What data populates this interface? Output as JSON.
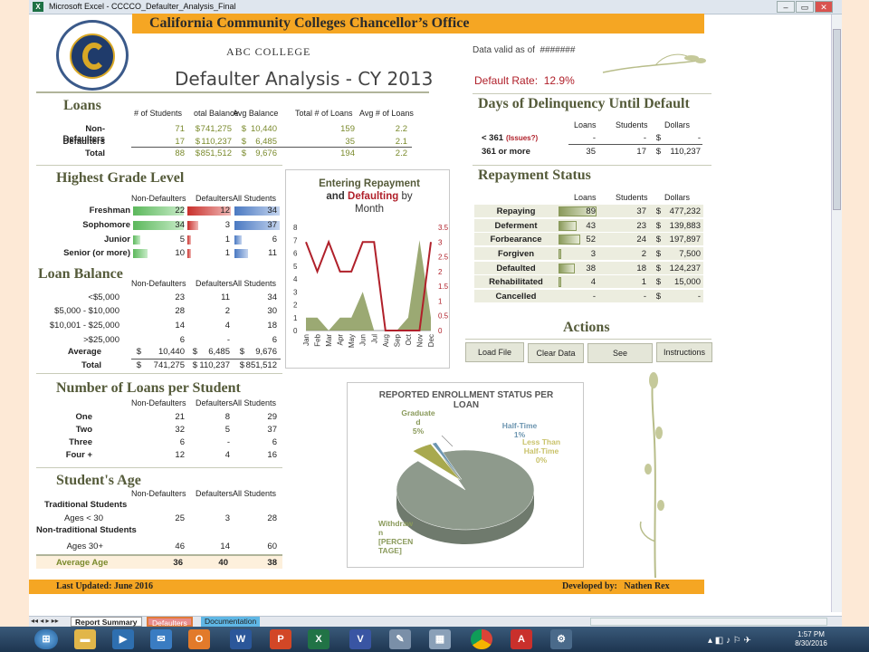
{
  "window": {
    "title": "Microsoft Excel - CCCCO_Defaulter_Analysis_Final"
  },
  "header": {
    "title": "California Community Colleges Chancellor’s Office",
    "seal_text": "CALIFORNIA COMMUNITY COLLEGES"
  },
  "report": {
    "college": "ABC COLLEGE",
    "title": "Defaulter Analysis - CY 2013",
    "valid_label": "Data valid as of",
    "valid_value": "#######",
    "default_rate_label": "Default Rate:",
    "default_rate_value": "12.9%"
  },
  "loans": {
    "title": "Loans",
    "headers": [
      "# of Students",
      "otal Balance",
      "Avg Balance",
      "Total # of Loans",
      "Avg # of Loans"
    ],
    "rows": [
      {
        "label": "Non-Defaulters",
        "students": "71",
        "bal_sym": "$",
        "balance": "741,275",
        "avg_sym": "$",
        "avg": "10,440",
        "loans": "159",
        "avg_loans": "2.2"
      },
      {
        "label": "Defaulters",
        "students": "17",
        "bal_sym": "$",
        "balance": "110,237",
        "avg_sym": "$",
        "avg": "6,485",
        "loans": "35",
        "avg_loans": "2.1"
      },
      {
        "label": "Total",
        "students": "88",
        "bal_sym": "$",
        "balance": "851,512",
        "avg_sym": "$",
        "avg": "9,676",
        "loans": "194",
        "avg_loans": "2.2"
      }
    ]
  },
  "grade": {
    "title": "Highest Grade Level",
    "headers": [
      "Non-Defaulters",
      "Defaulters",
      "All Students"
    ],
    "rows": [
      {
        "label": "Freshman",
        "non": "22",
        "def": "12",
        "all": "34",
        "non_frac": 1.0,
        "def_frac": 1.0,
        "all_frac": 1.0
      },
      {
        "label": "Sophomore",
        "non": "34",
        "def": "3",
        "all": "37",
        "non_frac": 1.0,
        "def_frac": 0.25,
        "all_frac": 1.0
      },
      {
        "label": "Junior",
        "non": "5",
        "def": "1",
        "all": "6",
        "non_frac": 0.15,
        "def_frac": 0.08,
        "all_frac": 0.16
      },
      {
        "label": "Senior (or more)",
        "non": "10",
        "def": "1",
        "all": "11",
        "non_frac": 0.29,
        "def_frac": 0.08,
        "all_frac": 0.3
      }
    ]
  },
  "loan_balance": {
    "title": "Loan Balance",
    "headers": [
      "Non-Defaulters",
      "Defaulters",
      "All Students"
    ],
    "rows": [
      {
        "label": "<$5,000",
        "non": "23",
        "def": "11",
        "all": "34"
      },
      {
        "label": "$5,000 - $10,000",
        "non": "28",
        "def": "2",
        "all": "30"
      },
      {
        "label": "$10,001 - $25,000",
        "non": "14",
        "def": "4",
        "all": "18"
      },
      {
        "label": ">$25,000",
        "non": "6",
        "def": "-",
        "all": "6"
      }
    ],
    "avg": {
      "label": "Average",
      "non": "10,440",
      "def": "6,485",
      "all": "9,676"
    },
    "total": {
      "label": "Total",
      "non": "741,275",
      "def": "110,237",
      "all": "851,512"
    }
  },
  "loans_per_student": {
    "title": "Number of Loans per Student",
    "headers": [
      "Non-Defaulters",
      "Defaulters",
      "All Students"
    ],
    "rows": [
      {
        "label": "One",
        "non": "21",
        "def": "8",
        "all": "29"
      },
      {
        "label": "Two",
        "non": "32",
        "def": "5",
        "all": "37"
      },
      {
        "label": "Three",
        "non": "6",
        "def": "-",
        "all": "6"
      },
      {
        "label": "Four +",
        "non": "12",
        "def": "4",
        "all": "16"
      }
    ]
  },
  "age": {
    "title": "Student's Age",
    "headers": [
      "Non-Defaulters",
      "Defaulters",
      "All Students"
    ],
    "traditional": "Traditional Students",
    "nontraditional": "Non-traditional Students",
    "rows": [
      {
        "label": "Ages < 30",
        "non": "25",
        "def": "3",
        "all": "28"
      },
      {
        "label": "Ages 30+",
        "non": "46",
        "def": "14",
        "all": "60"
      }
    ],
    "avg": {
      "label": "Average Age",
      "non": "36",
      "def": "40",
      "all": "38"
    }
  },
  "delinquency": {
    "title": "Days of Delinquency Until Default",
    "headers": [
      "Loans",
      "Students",
      "Dollars"
    ],
    "rows": [
      {
        "label": "< 361",
        "tag": "(Issues?)",
        "loans": "-",
        "students": "-",
        "sym": "$",
        "dollars": "-"
      },
      {
        "label": "361 or more",
        "tag": "",
        "loans": "35",
        "students": "17",
        "sym": "$",
        "dollars": "110,237"
      }
    ]
  },
  "repayment": {
    "title": "Repayment Status",
    "headers": [
      "Loans",
      "Students",
      "Dollars"
    ],
    "rows": [
      {
        "label": "Repaying",
        "loans": "89",
        "students": "37",
        "sym": "$",
        "dollars": "477,232",
        "frac": 1.0
      },
      {
        "label": "Deferment",
        "loans": "43",
        "students": "23",
        "sym": "$",
        "dollars": "139,883",
        "frac": 0.48
      },
      {
        "label": "Forbearance",
        "loans": "52",
        "students": "24",
        "sym": "$",
        "dollars": "197,897",
        "frac": 0.58
      },
      {
        "label": "Forgiven",
        "loans": "3",
        "students": "2",
        "sym": "$",
        "dollars": "7,500",
        "frac": 0.03
      },
      {
        "label": "Defaulted",
        "loans": "38",
        "students": "18",
        "sym": "$",
        "dollars": "124,237",
        "frac": 0.43
      },
      {
        "label": "Rehabilitated",
        "loans": "4",
        "students": "1",
        "sym": "$",
        "dollars": "15,000",
        "frac": 0.04
      },
      {
        "label": "Cancelled",
        "loans": "-",
        "students": "-",
        "sym": "$",
        "dollars": "-",
        "frac": 0
      }
    ]
  },
  "actions": {
    "title": "Actions",
    "buttons": [
      "Load File",
      "Clear Data",
      "See",
      "Instructions"
    ]
  },
  "chart_data": [
    {
      "type": "line",
      "title": "Entering Repayment and Defaulting by Month",
      "title_parts": [
        "Entering Repayment",
        "and",
        "Defaulting",
        "by",
        "Month"
      ],
      "categories": [
        "Jan",
        "Feb",
        "Mar",
        "Apr",
        "May",
        "Jun",
        "Jul",
        "Aug",
        "Sep",
        "Oct",
        "Nov",
        "Dec"
      ],
      "series": [
        {
          "name": "Entering Repayment",
          "kind": "area",
          "axis": "left",
          "color": "#8a9a5b",
          "values": [
            1,
            1,
            0,
            1,
            1,
            3,
            0,
            0,
            0,
            1,
            7,
            1
          ]
        },
        {
          "name": "Defaulting",
          "kind": "line",
          "axis": "right",
          "color": "#b0202a",
          "values": [
            3,
            2,
            3,
            2,
            2,
            3,
            3,
            0,
            0,
            0,
            0,
            3
          ]
        }
      ],
      "ylim_left": [
        0,
        8
      ],
      "ylim_right": [
        0,
        3.5
      ],
      "yticks_left": [
        "0",
        "1",
        "2",
        "3",
        "4",
        "5",
        "6",
        "7",
        "8"
      ],
      "yticks_right": [
        "0",
        "0.5",
        "1",
        "1.5",
        "2",
        "2.5",
        "3",
        "3.5"
      ]
    },
    {
      "type": "pie",
      "title": "REPORTED ENROLLMENT STATUS PER LOAN",
      "slices": [
        {
          "label": "Withdrawn",
          "value_text": "[PERCENTAGE]",
          "value": 94,
          "color": "#8e9a8c"
        },
        {
          "label": "Graduated",
          "value_text": "5%",
          "value": 5,
          "color": "#a8a94e"
        },
        {
          "label": "Half-Time",
          "value_text": "1%",
          "value": 1,
          "color": "#6c95b0"
        },
        {
          "label": "Less Than Half-Time",
          "value_text": "0%",
          "value": 0,
          "color": "#c9c26a"
        }
      ]
    }
  ],
  "footer": {
    "last_updated": "Last Updated: June 2016",
    "developed_label": "Developed by:",
    "developed_by": "Nathen Rex"
  },
  "sheet_tabs": [
    "Report Summary",
    "Defaulters",
    "Documentation"
  ],
  "clock": {
    "time": "1:57 PM",
    "date": "8/30/2016"
  }
}
